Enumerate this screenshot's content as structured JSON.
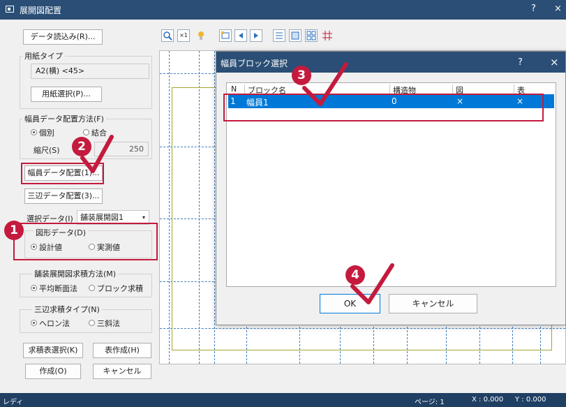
{
  "window": {
    "title": "展開図配置",
    "help": "?",
    "close": "×"
  },
  "left": {
    "read_data": "データ読込み(R)...",
    "paper_type": {
      "title": "用紙タイプ",
      "value": "A2(横) <45>",
      "select_button": "用紙選択(P)..."
    },
    "width_method": {
      "title": "幅員データ配置方法(F)",
      "opt_individual": "個別",
      "opt_combined": "結合",
      "scale_label": "縮尺(S)",
      "scale_value": "250"
    },
    "width_place_button": "幅員データ配置(1)...",
    "trilateral_button": "三辺データ配置(3)...",
    "select_data": {
      "label": "選択データ(I)",
      "value": "舗装展開図1"
    },
    "figure_data": {
      "title": "図形データ(D)",
      "opt_design": "設計値",
      "opt_measured": "実測値"
    },
    "area_method": {
      "title": "舗装展開図求積方法(M)",
      "opt_avg": "平均断面法",
      "opt_block": "ブロック求積"
    },
    "tri_type": {
      "title": "三辺求積タイプ(N)",
      "opt_heron": "ヘロン法",
      "opt_triangle": "三斜法"
    },
    "area_table_button": "求積表選択(K)",
    "table_create_button": "表作成(H)",
    "create_button": "作成(O)",
    "cancel_button": "キャンセル"
  },
  "toolbar": {
    "icons": [
      "zoom-icon",
      "fit-icon",
      "light-icon",
      "block-icon",
      "prev-icon",
      "next-icon",
      "list-icon",
      "edit-icon",
      "layout-icon",
      "grid-icon"
    ]
  },
  "dialog": {
    "title": "幅員ブロック選択",
    "help": "?",
    "close": "×",
    "columns": [
      "N",
      "ブロック名",
      "構造物",
      "図",
      "表"
    ],
    "rows": [
      {
        "n": "1",
        "name": "幅員1",
        "structure": "0",
        "fig": "×",
        "table": "×"
      }
    ],
    "ok": "OK",
    "cancel": "キャンセル"
  },
  "status": {
    "state": "レディ",
    "page": "ページ: 1",
    "x": "X : 0.000",
    "y": "Y : 0.000"
  },
  "markers": [
    "1",
    "2",
    "3",
    "4"
  ],
  "colors": {
    "accent": "#c41a3d",
    "titlebar": "#2a4e75",
    "selection": "#0078d7"
  }
}
